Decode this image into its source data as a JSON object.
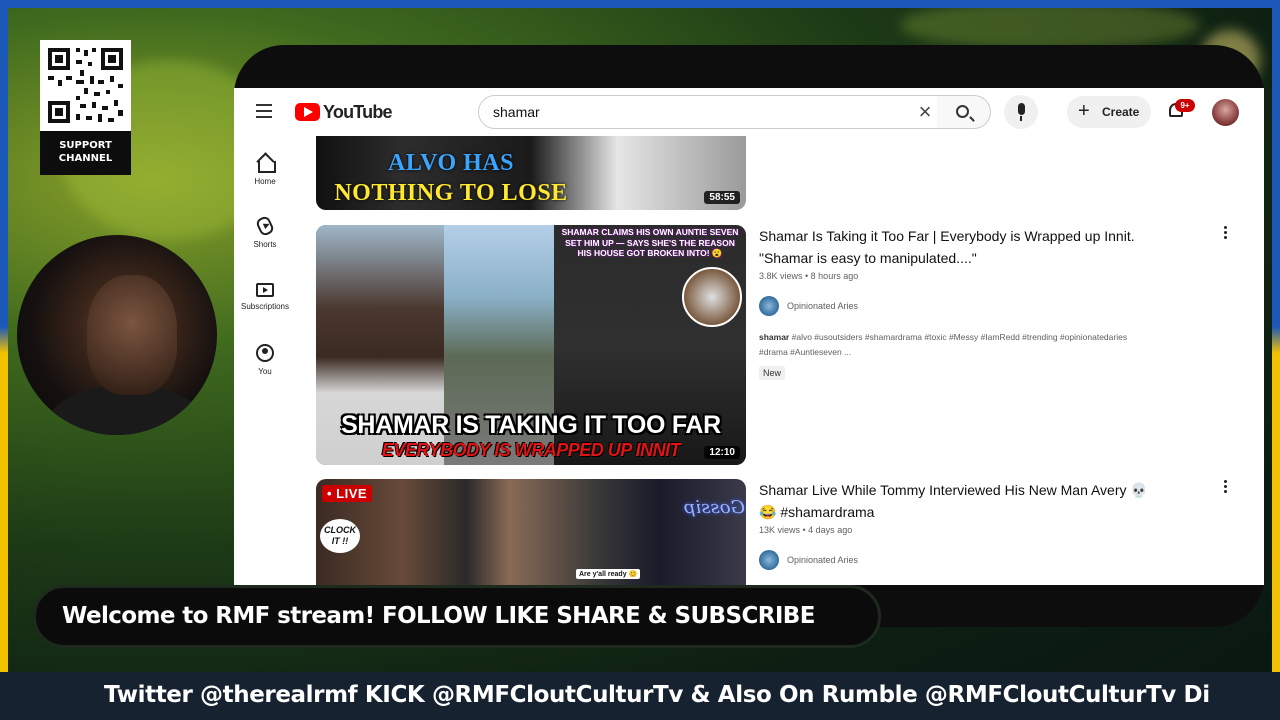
{
  "overlay": {
    "support_line1": "SUPPORT",
    "support_line2": "CHANNEL",
    "welcome": "Welcome to RMF stream! FOLLOW LIKE SHARE & SUBSCRIBE",
    "ticker": "Twitter @therealrmf KICK @RMFCloutCulturTv & Also On Rumble @RMFCloutCulturTv Di"
  },
  "youtube": {
    "logo_text": "YouTube",
    "search": {
      "value": "shamar"
    },
    "create_label": "Create",
    "notification_count": "9+",
    "sidebar": [
      {
        "label": "Home",
        "icon": "home-icon"
      },
      {
        "label": "Shorts",
        "icon": "shorts-icon"
      },
      {
        "label": "Subscriptions",
        "icon": "subscriptions-icon"
      },
      {
        "label": "You",
        "icon": "you-icon"
      }
    ],
    "results": [
      {
        "thumb_text_1": "ALVO HAS",
        "thumb_text_2": "NOTHING TO LOSE",
        "duration": "58:55"
      },
      {
        "title_line1": "Shamar Is Taking it Too Far | Everybody is Wrapped up Innit.",
        "title_line2": "\"Shamar is easy to manipulated....\"",
        "stats": "3.8K views • 8 hours ago",
        "channel": "Opinionated Aries",
        "tags_bold": "shamar",
        "tags_line1": " #alvo #usoutsiders #shamardrama #toxic #Messy #IamRedd #trending #opinionatedaries",
        "tags_line2": "#drama #Auntieseven ...",
        "badge": "New",
        "thumb_claim": "SHAMAR CLAIMS HIS OWN AUNTIE SEVEN SET HIM UP — SAYS SHE'S THE REASON HIS HOUSE GOT BROKEN INTO! 😮",
        "thumb_big": "SHAMAR IS TAKING IT TOO FAR",
        "thumb_sub": "EVERYBODY IS WRAPPED UP INNIT",
        "duration": "12:10"
      },
      {
        "title_line1": "Shamar Live While Tommy Interviewed His New Man Avery 💀",
        "title_line2": "😂 #shamardrama",
        "stats": "13K views • 4 days ago",
        "channel": "Opinionated Aries",
        "live_label": "• LIVE",
        "thumb_clock": "CLOCK IT !!",
        "thumb_gossip": "Gossip",
        "thumb_ready": "Are y'all ready 😊"
      }
    ]
  },
  "colors": {
    "youtube_red": "#ff0000",
    "live_red": "#cc0000",
    "frame_black": "#0d0d0d",
    "border_blue": "#1b58b8",
    "border_yellow": "#f2c200"
  }
}
